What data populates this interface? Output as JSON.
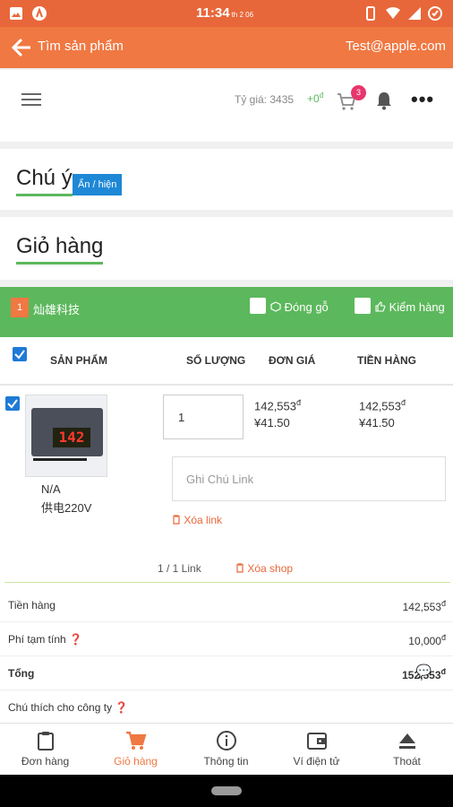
{
  "status_bar": {
    "time": "11:34",
    "date_small": "th 2 06"
  },
  "app_bar": {
    "title": "Tìm sản phẩm",
    "user": "Test@apple.com"
  },
  "toolbar": {
    "rate_label": "Tỷ giá: 3435",
    "balance": "+0",
    "currency_symbol": "đ",
    "cart_count": "3"
  },
  "notice": {
    "title": "Chú ý",
    "toggle_label": "Ẩn / hiện"
  },
  "cart": {
    "title": "Giỏ hàng"
  },
  "shop": {
    "index": "1",
    "name": "灿雄科技",
    "option_wood": "Đóng gỗ",
    "option_check": "Kiểm hàng"
  },
  "table": {
    "headers": [
      "SẢN PHẨM",
      "SỐ LƯỢNG",
      "ĐƠN GIÁ",
      "TIỀN HÀNG"
    ]
  },
  "item": {
    "attr1": "N/A",
    "attr2": "供电220V",
    "quantity": "1",
    "unit_price_vnd": "142,553",
    "unit_price_cny": "¥41.50",
    "total_vnd": "142,553",
    "total_cny": "¥41.50",
    "note_placeholder": "Ghi Chú Link",
    "delete_link": "Xóa link",
    "lcd": "142"
  },
  "link_count": "1 / 1 Link",
  "delete_shop": "Xóa shop",
  "summary": [
    {
      "label": "Tiền hàng",
      "value": "142,553"
    },
    {
      "label": "Phí tạm tính",
      "value": "10,000"
    },
    {
      "label": "Tổng",
      "value": "152,553"
    }
  ],
  "company_note_label": "Chú thích cho công ty",
  "bottom_nav": [
    {
      "label": "Đơn hàng",
      "icon": "clipboard-icon"
    },
    {
      "label": "Giỏ hàng",
      "icon": "cart-icon"
    },
    {
      "label": "Thông tin",
      "icon": "info-icon"
    },
    {
      "label": "Ví điện tử",
      "icon": "wallet-icon"
    },
    {
      "label": "Thoát",
      "icon": "eject-icon"
    }
  ],
  "colors": {
    "primary": "#f07842",
    "status_bar": "#e8673a",
    "green": "#5cb85c",
    "blue": "#1e88d6"
  }
}
